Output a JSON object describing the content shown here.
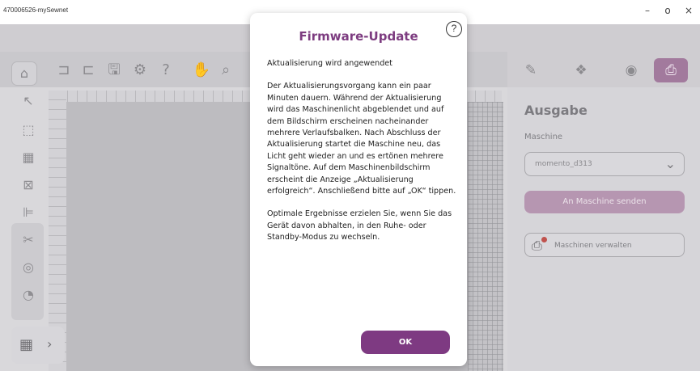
{
  "window": {
    "title": "470006526-mySewnet",
    "minimize_glyph": "–",
    "maximize_glyph": "o",
    "close_glyph": "×"
  },
  "toolbar": {
    "icons": [
      "home-icon",
      "undo-icon",
      "redo-icon",
      "save-icon",
      "settings-icon",
      "help-icon",
      "pan-icon",
      "zoom-icon"
    ]
  },
  "left_tools": {
    "icons": [
      "select-icon",
      "marquee-select-icon",
      "group-icon",
      "ungroup-icon",
      "align-icon",
      "cut-icon",
      "weld-icon",
      "fill-icon"
    ]
  },
  "right_tabs": {
    "icons": [
      "edit-icon",
      "layers-icon",
      "preview-icon",
      "output-icon"
    ]
  },
  "right_panel": {
    "heading": "Ausgabe",
    "machine_label": "Maschine",
    "machine_value": "momento_d313",
    "send_button": "An Maschine senden",
    "manage_button": "Maschinen verwalten"
  },
  "modal": {
    "title": "Firmware-Update",
    "status": "Aktualisierung wird angewendet",
    "paragraph1": "Der Aktualisierungsvorgang kann ein paar Minuten dauern. Während der Aktualisierung wird das Maschinenlicht abgeblendet und auf dem Bildschirm erscheinen nacheinander mehrere Verlaufsbalken. Nach Abschluss der Aktualisierung startet die Maschine neu, das Licht geht wieder an und es ertönen mehrere Signaltöne. Auf dem Maschinenbildschirm erscheint die Anzeige „Aktualisierung erfolgreich“. Anschließend bitte auf „OK“ tippen.",
    "paragraph2": "Optimale Ergebnisse erzielen Sie, wenn Sie das Gerät davon abhalten, in den Ruhe- oder Standby-Modus zu wechseln.",
    "ok_button": "OK"
  },
  "colors": {
    "accent": "#7e3a82",
    "accent_dimmed": "#a27a9d"
  }
}
